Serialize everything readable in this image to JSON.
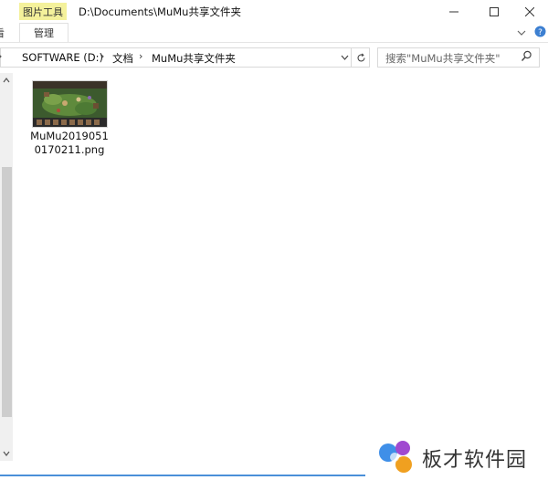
{
  "window": {
    "context_tab": "图片工具",
    "title": "D:\\Documents\\MuMu共享文件夹",
    "controls": {
      "minimize": "—",
      "maximize": "☐",
      "close": "✕"
    }
  },
  "ribbon": {
    "left_tab_fragment": "看",
    "manage_tab": "管理"
  },
  "address": {
    "crumbs": [
      "SOFTWARE (D:)",
      "文档",
      "MuMu共享文件夹"
    ],
    "separator": "›"
  },
  "search": {
    "placeholder": "搜索\"MuMu共享文件夹\""
  },
  "files": [
    {
      "name": "MuMu20190510170211.png",
      "name_line1": "MuMu2019051",
      "name_line2": "0170211.png"
    }
  ],
  "watermark": {
    "text": "板才软件园"
  },
  "colors": {
    "context_tab_bg": "#f4f19b",
    "accent": "#4a90d9"
  }
}
